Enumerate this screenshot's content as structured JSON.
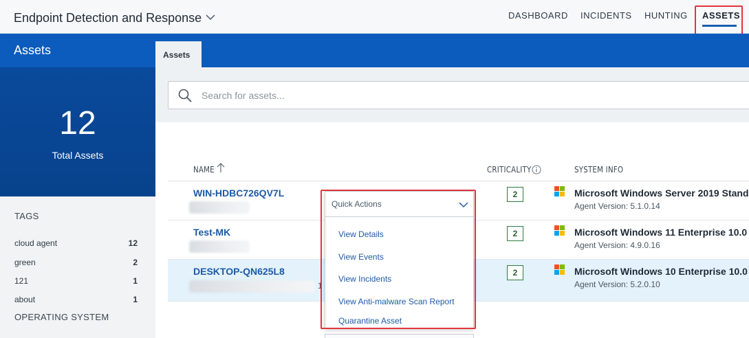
{
  "app": {
    "title": "Endpoint Detection and Response"
  },
  "nav": {
    "items": [
      {
        "label": "DASHBOARD"
      },
      {
        "label": "INCIDENTS"
      },
      {
        "label": "HUNTING"
      },
      {
        "label": "ASSETS"
      }
    ],
    "active": "ASSETS"
  },
  "page": {
    "title": "Assets",
    "tab_label": "Assets"
  },
  "summary": {
    "total_count": "12",
    "total_label": "Total Assets"
  },
  "sidebar": {
    "tags_heading": "TAGS",
    "tags": [
      {
        "label": "cloud agent",
        "count": "12"
      },
      {
        "label": "green",
        "count": "2"
      },
      {
        "label": "121",
        "count": "1"
      },
      {
        "label": "about",
        "count": "1"
      }
    ],
    "os_heading": "OPERATING SYSTEM"
  },
  "search": {
    "placeholder": "Search for assets..."
  },
  "table": {
    "columns": {
      "name": "NAME",
      "criticality": "CRITICALITY",
      "system_info": "SYSTEM INFO"
    },
    "rows": [
      {
        "name": "WIN-HDBC726QV7L",
        "criticality": "2",
        "os": "Microsoft Windows Server 2019 Stand",
        "agent_version": "Agent Version: 5.1.0.14"
      },
      {
        "name": "Test-MK",
        "criticality": "2",
        "os": "Microsoft Windows 11 Enterprise 10.0",
        "agent_version": "Agent Version: 4.9.0.16"
      },
      {
        "name": "DESKTOP-QN625L8",
        "criticality": "2",
        "os": "Microsoft Windows 10 Enterprise 10.0",
        "agent_version": "Agent Version: 5.2.0.10"
      }
    ],
    "stray_text": "1"
  },
  "quick_actions": {
    "title": "Quick Actions",
    "items": [
      {
        "label": "View Details"
      },
      {
        "label": "View Events"
      },
      {
        "label": "View Incidents"
      },
      {
        "label": "View Anti-malware Scan Report"
      },
      {
        "label": "Quarantine Asset"
      }
    ]
  },
  "colors": {
    "brand_blue": "#0b5cbc",
    "link_blue": "#1c5aa6",
    "highlight_box": "#e0353c",
    "row_highlight": "#e3f2fb",
    "criticality_border": "#2f7a3d"
  },
  "icons": {
    "app_dropdown": "chevron-down-icon",
    "search": "search-icon",
    "sort": "arrow-up-icon",
    "info": "info-icon",
    "os": "windows-logo-icon",
    "quick_actions_dropdown": "chevron-down-icon"
  }
}
